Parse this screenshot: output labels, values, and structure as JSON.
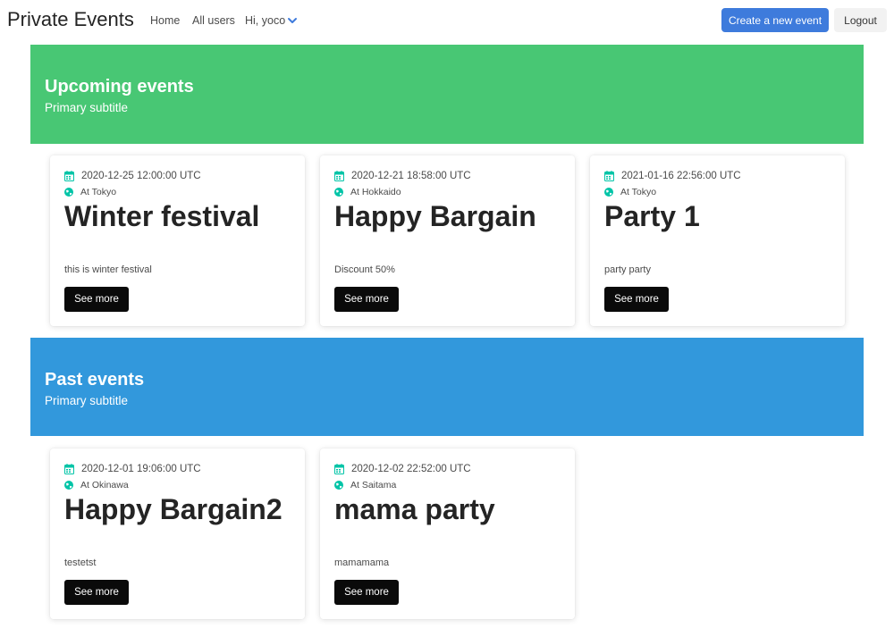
{
  "navbar": {
    "brand": "Private Events",
    "links": [
      "Home",
      "All users"
    ],
    "user_menu": "Hi, yoco",
    "create_label": "Create a new event",
    "logout_label": "Logout"
  },
  "icons": {
    "date": "calendar-icon",
    "location": "globe-icon",
    "dropdown": "chevron-down-icon"
  },
  "colors": {
    "upcoming_banner": "#48c774",
    "past_banner": "#3298dc",
    "primary_button": "#3e7bdc",
    "card_button": "#0a0a0a",
    "icon_accent": "#00c4a7"
  },
  "sections": [
    {
      "title": "Upcoming events",
      "subtitle": "Primary subtitle",
      "events": [
        {
          "date": "2020-12-25 12:00:00 UTC",
          "location": "At Tokyo",
          "name": "Winter festival",
          "description": "this is winter festival",
          "button": "See more"
        },
        {
          "date": "2020-12-21 18:58:00 UTC",
          "location": "At Hokkaido",
          "name": "Happy Bargain",
          "description": "Discount 50%",
          "button": "See more"
        },
        {
          "date": "2021-01-16 22:56:00 UTC",
          "location": "At Tokyo",
          "name": "Party 1",
          "description": "party party",
          "button": "See more"
        }
      ]
    },
    {
      "title": "Past events",
      "subtitle": "Primary subtitle",
      "events": [
        {
          "date": "2020-12-01 19:06:00 UTC",
          "location": "At Okinawa",
          "name": "Happy Bargain2",
          "description": "testetst",
          "button": "See more"
        },
        {
          "date": "2020-12-02 22:52:00 UTC",
          "location": "At Saitama",
          "name": "mama party",
          "description": "mamamama",
          "button": "See more"
        }
      ]
    }
  ]
}
